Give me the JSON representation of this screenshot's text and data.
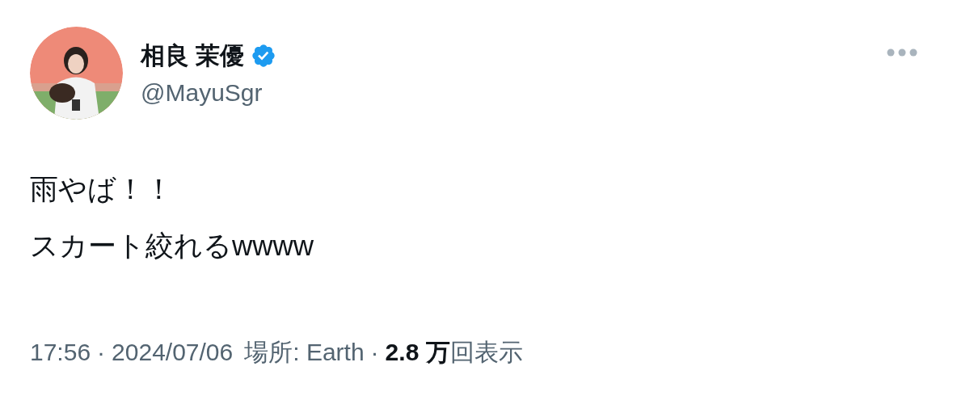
{
  "author": {
    "name": "相良 茉優",
    "verified": true,
    "handle": "@MayuSgr"
  },
  "body_lines": [
    "雨やば！！",
    "スカート絞れるwwww"
  ],
  "meta": {
    "time": "17:56",
    "separator_1": "·",
    "date": "2024/07/06",
    "location": "場所: Earth",
    "separator_2": "·",
    "views_count": "2.8 万",
    "views_label": "回表示"
  }
}
